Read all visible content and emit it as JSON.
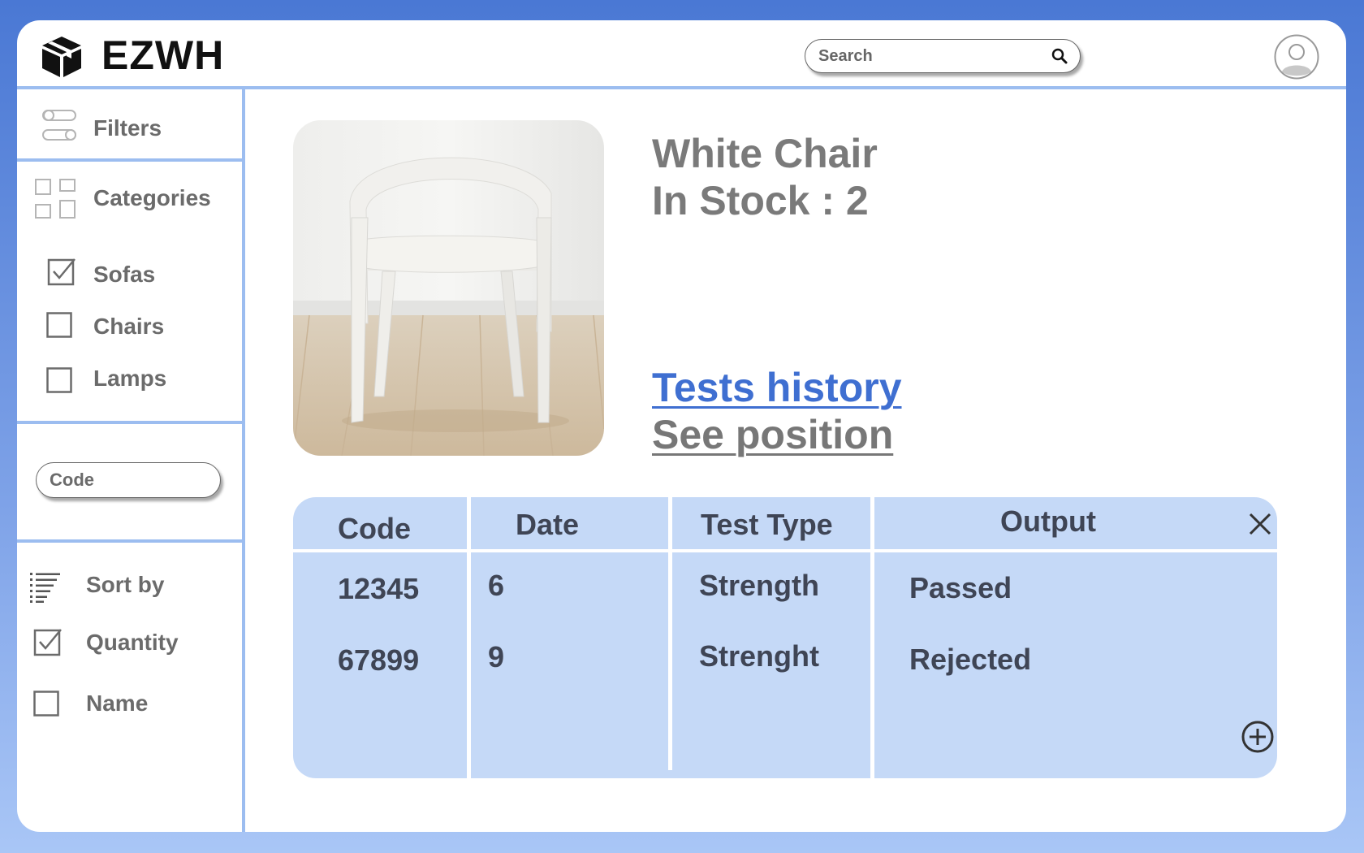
{
  "app": {
    "title": "EZWH",
    "logo_icon": "box-icon"
  },
  "header": {
    "search": {
      "placeholder": "Search",
      "icon": "search-icon"
    },
    "avatar_icon": "user-avatar-icon"
  },
  "sidebar": {
    "filters_label": "Filters",
    "categories_label": "Categories",
    "categories": [
      {
        "label": "Sofas",
        "checked": true
      },
      {
        "label": "Chairs",
        "checked": false
      },
      {
        "label": "Lamps",
        "checked": false
      }
    ],
    "code_placeholder": "Code",
    "sort_label": "Sort by",
    "sort_options": [
      {
        "label": "Quantity",
        "checked": true
      },
      {
        "label": "Name",
        "checked": false
      }
    ]
  },
  "product": {
    "name": "White Chair",
    "stock_text": "In Stock : 2",
    "image_icon": "chair-photo",
    "tests_history_link": "Tests history",
    "see_position_link": "See position"
  },
  "tests_table": {
    "headers": [
      "Code",
      "Date",
      "Test Type",
      "Output"
    ],
    "rows": [
      {
        "code": "12345",
        "date": "6",
        "test_type": "Strength",
        "output": "Passed"
      },
      {
        "code": "67899",
        "date": "9",
        "test_type": "Strenght",
        "output": "Rejected"
      }
    ],
    "close_icon": "close-icon",
    "add_icon": "add-circle-icon"
  },
  "colors": {
    "background_gradient_top": "#4a78d4",
    "background_gradient_bottom": "#a9c6f6",
    "divider": "#9cbdf0",
    "table_bg": "#c5d9f7",
    "link_blue": "#3f6fd1",
    "text_gray": "#7a7a7a"
  }
}
